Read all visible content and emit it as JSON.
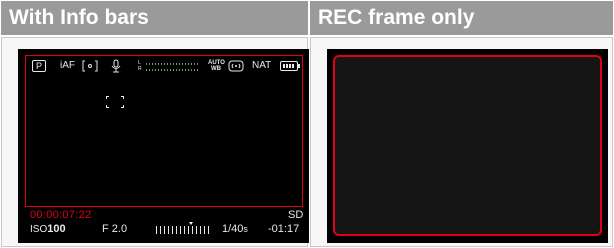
{
  "headers": {
    "left": "With Info bars",
    "right": "REC frame only"
  },
  "top_bar": {
    "mode": "P",
    "focus": "iAF",
    "metering_icon": "spot-metering-icon",
    "mic_icon": "microphone-icon",
    "level_l": "L",
    "level_r": "R",
    "awb_top": "AUTO",
    "awb_bottom": "WB",
    "stabilizer_icon": "stabilizer-icon",
    "film_style": "NAT",
    "battery_icon": "battery-icon"
  },
  "bottom_bar": {
    "timecode": "00:00:07:22",
    "storage": "SD",
    "iso_label": "ISO",
    "iso_value": "100",
    "aperture": "F 2.0",
    "shutter_value": "1/40",
    "shutter_unit": "s",
    "remaining": "-01:17"
  },
  "colors": {
    "header_bg": "#9a9a9a",
    "rec_frame": "#e0001a",
    "screen_bg": "#000000"
  }
}
